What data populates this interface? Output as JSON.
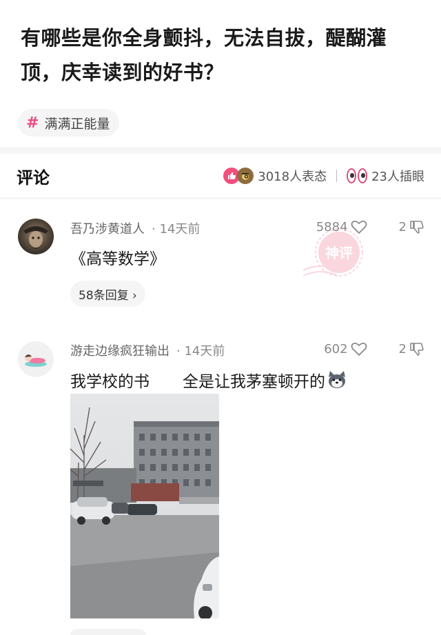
{
  "question": {
    "title": "有哪些是你全身颤抖，无法自拔，醍醐灌顶，庆幸读到的好书？"
  },
  "topic": {
    "hash": "#",
    "label": "满满正能量"
  },
  "comments_header": {
    "title": "评论",
    "reactions_text": "3018人表态",
    "peek_text": "23人插眼"
  },
  "comments": [
    {
      "username": "吾乃涉黄道人",
      "time": "· 14天前",
      "likes": "5884",
      "dislikes": "2",
      "text": "《高等数学》",
      "replies": "58条回复 ›",
      "badge": "神评"
    },
    {
      "username": "游走边缘疯狂输出",
      "time": "· 14天前",
      "likes": "602",
      "dislikes": "2",
      "text_part1": "我学校的书",
      "text_part2": "全是让我茅塞顿开的",
      "emoji": "husky-icon"
    }
  ],
  "colors": {
    "accent": "#ee4d82",
    "divider": "#f5f5f5"
  }
}
